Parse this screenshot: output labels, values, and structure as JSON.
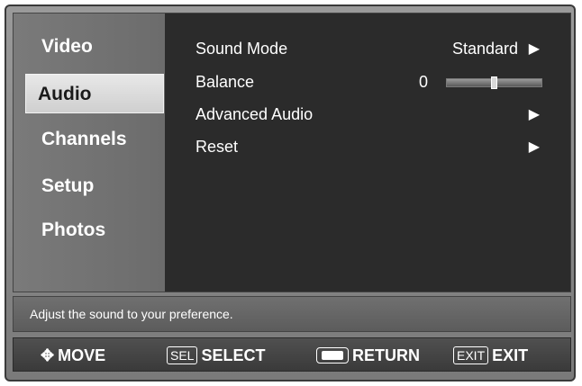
{
  "sidebar": {
    "items": [
      {
        "label": "Video"
      },
      {
        "label": "Audio",
        "selected": true
      },
      {
        "label": "Channels"
      },
      {
        "label": "Setup"
      },
      {
        "label": "Photos"
      }
    ]
  },
  "audio_menu": {
    "sound_mode": {
      "label": "Sound Mode",
      "value": "Standard"
    },
    "balance": {
      "label": "Balance",
      "value": "0",
      "level_fraction": 0.5
    },
    "advanced_audio": {
      "label": "Advanced Audio"
    },
    "reset": {
      "label": "Reset"
    }
  },
  "help": {
    "text": "Adjust the sound to your preference."
  },
  "nav": {
    "move_label": "MOVE",
    "sel_key": "SEL",
    "select_label": "SELECT",
    "return_label": "RETURN",
    "exit_key": "EXIT",
    "exit_label": "EXIT"
  },
  "glyphs": {
    "arrow_right": "▶",
    "move_icon": "✥"
  },
  "colors": {
    "panel_bg": "#2b2b2b",
    "sidebar_bg": "#6e6e6e",
    "selected_bg": "#dcdcdc",
    "text": "#ffffff"
  }
}
